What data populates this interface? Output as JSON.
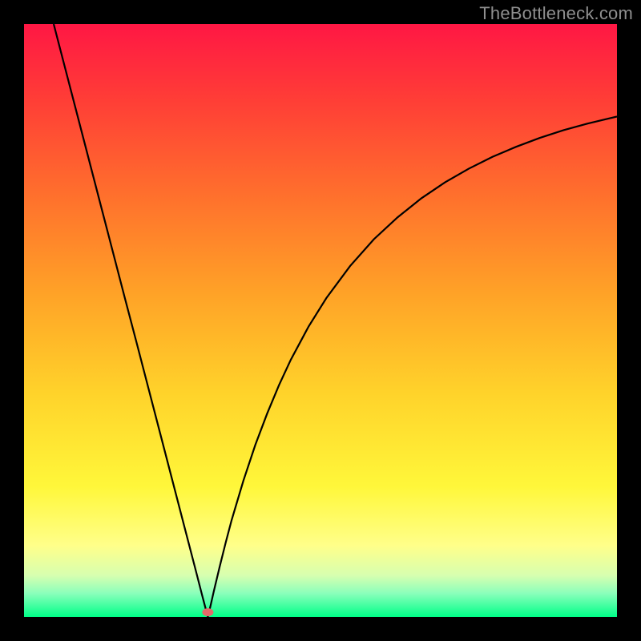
{
  "watermark": "TheBottleneck.com",
  "chart_data": {
    "type": "line",
    "title": "",
    "xlabel": "",
    "ylabel": "",
    "xlim": [
      0,
      100
    ],
    "ylim": [
      0,
      100
    ],
    "grid": false,
    "legend": false,
    "background_gradient_stops": [
      {
        "offset": 0.0,
        "color": "#ff1744"
      },
      {
        "offset": 0.12,
        "color": "#ff3b37"
      },
      {
        "offset": 0.28,
        "color": "#ff6d2d"
      },
      {
        "offset": 0.45,
        "color": "#ffa127"
      },
      {
        "offset": 0.62,
        "color": "#ffd22a"
      },
      {
        "offset": 0.78,
        "color": "#fff73a"
      },
      {
        "offset": 0.88,
        "color": "#ffff8a"
      },
      {
        "offset": 0.93,
        "color": "#d7ffb0"
      },
      {
        "offset": 0.96,
        "color": "#8bffbb"
      },
      {
        "offset": 1.0,
        "color": "#00ff88"
      }
    ],
    "optimal_point": {
      "x": 31,
      "y": 0
    },
    "marker": {
      "x": 31,
      "y": 0.8,
      "color": "#e46a6a",
      "rx": 7,
      "ry": 5
    },
    "series": [
      {
        "name": "bottleneck-curve",
        "color": "#000000",
        "x": [
          5.0,
          7.0,
          9.0,
          11.0,
          13.0,
          15.0,
          17.0,
          19.0,
          21.0,
          23.0,
          25.0,
          27.0,
          29.0,
          30.0,
          30.5,
          31.0,
          31.5,
          32.0,
          33.0,
          34.0,
          35.0,
          37.0,
          39.0,
          41.0,
          43.0,
          45.0,
          48.0,
          51.0,
          55.0,
          59.0,
          63.0,
          67.0,
          71.0,
          75.0,
          79.0,
          83.0,
          87.0,
          91.0,
          95.0,
          100.0
        ],
        "y": [
          100.0,
          92.3,
          84.6,
          76.9,
          69.2,
          61.5,
          53.8,
          46.2,
          38.5,
          30.8,
          23.1,
          15.4,
          7.7,
          3.8,
          1.9,
          0.0,
          2.1,
          4.3,
          8.5,
          12.5,
          16.3,
          23.0,
          29.0,
          34.3,
          39.1,
          43.4,
          49.0,
          53.8,
          59.2,
          63.7,
          67.4,
          70.6,
          73.3,
          75.6,
          77.6,
          79.3,
          80.8,
          82.1,
          83.2,
          84.4
        ]
      }
    ]
  }
}
